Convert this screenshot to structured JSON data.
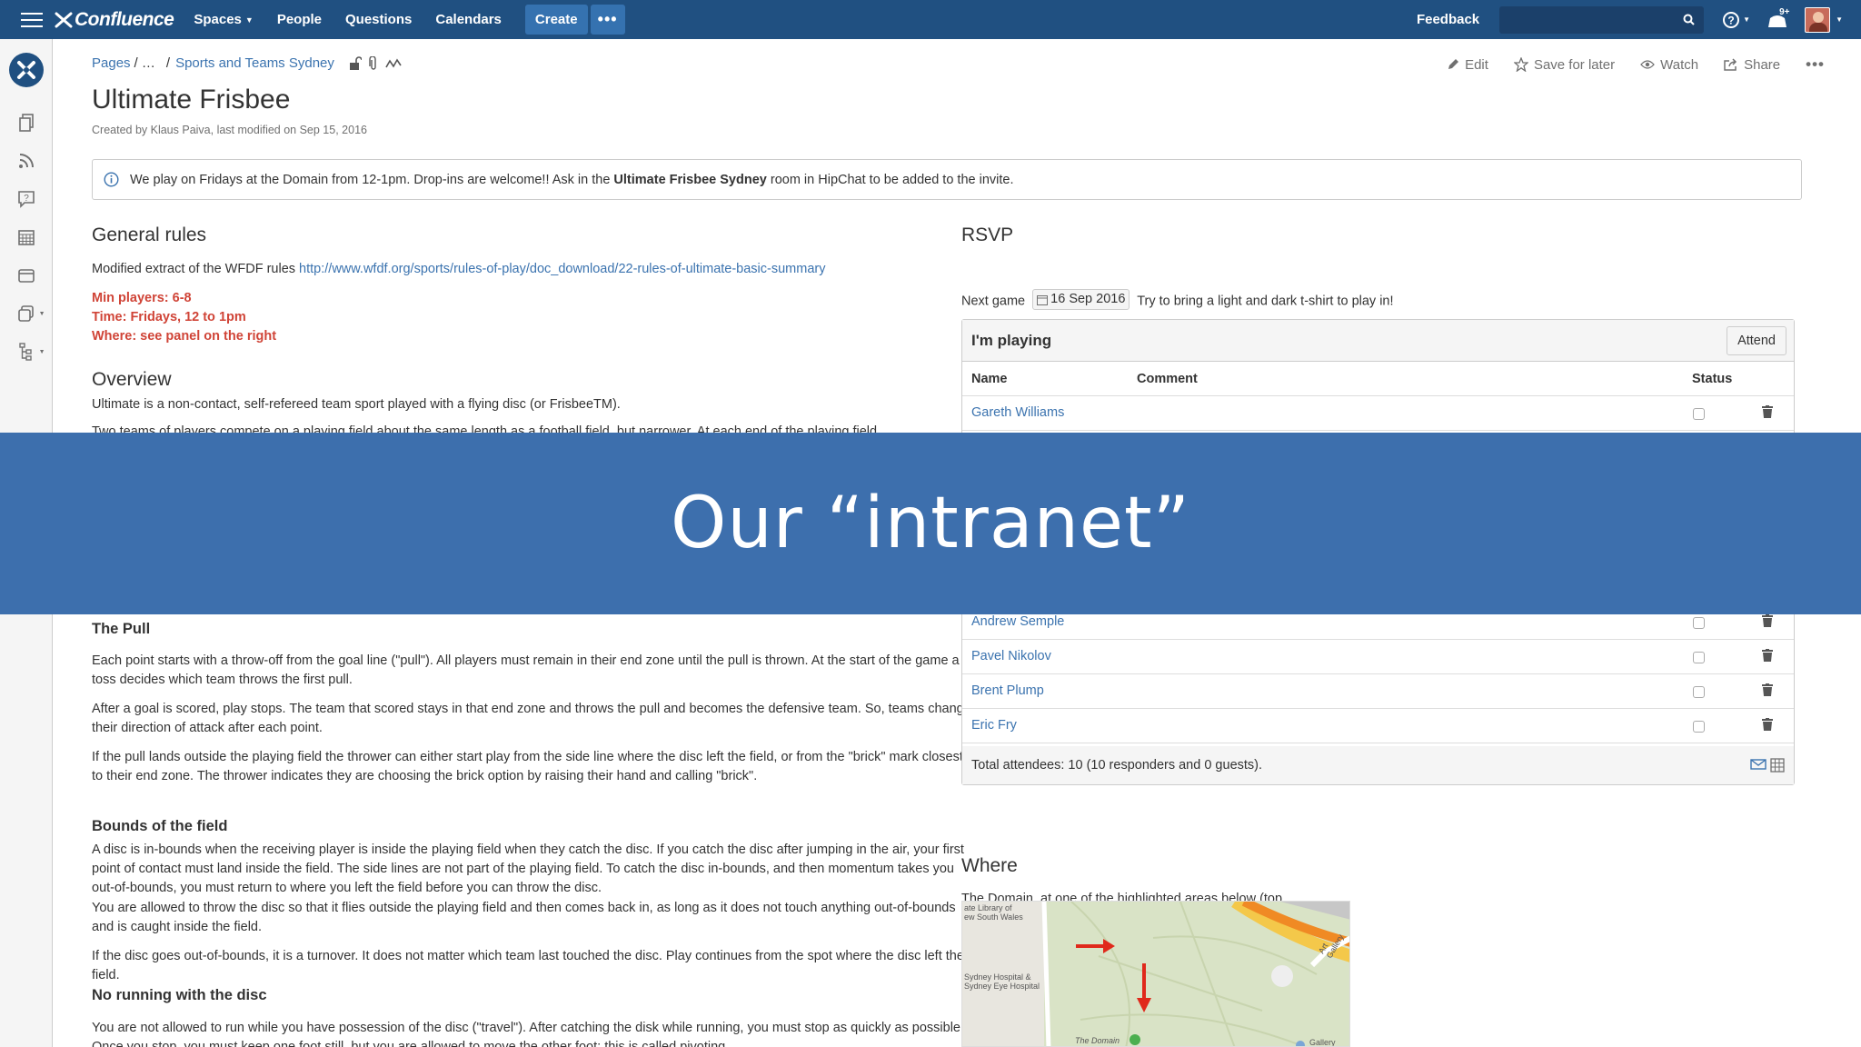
{
  "nav": {
    "app_name": "Confluence",
    "items": [
      {
        "label": "Spaces",
        "has_caret": true
      },
      {
        "label": "People",
        "has_caret": false
      },
      {
        "label": "Questions",
        "has_caret": false
      },
      {
        "label": "Calendars",
        "has_caret": false
      }
    ],
    "create_label": "Create",
    "more_label": "•••",
    "feedback_label": "Feedback",
    "notifications_badge": "9+"
  },
  "breadcrumb": {
    "root": "Pages",
    "ellipsis": "/ …",
    "sep": "/",
    "parent": "Sports and Teams Sydney"
  },
  "page_actions": {
    "edit": "Edit",
    "save_for_later": "Save for later",
    "watch": "Watch",
    "share": "Share",
    "more": "•••"
  },
  "page": {
    "title": "Ultimate Frisbee",
    "byline": "Created by Klaus Paiva, last modified on Sep 15, 2016"
  },
  "info_panel": {
    "text_before": "We play on Fridays at the Domain from 12-1pm. Drop-ins are welcome!! Ask in the ",
    "bold": "Ultimate Frisbee Sydney",
    "text_after": " room in HipChat to be added to the invite."
  },
  "general_rules": {
    "heading": "General rules",
    "extract_text": "Modified extract of the WFDF rules ",
    "extract_link": "http://www.wfdf.org/sports/rules-of-play/doc_download/22-rules-of-ultimate-basic-summary",
    "red_lines": [
      "Min players: 6-8",
      "Time: Fridays, 12 to 1pm",
      "Where: see panel on the right"
    ]
  },
  "overview": {
    "heading": "Overview",
    "line1": "Ultimate is a non-contact, self-refereed team sport played with a flying disc (or FrisbeeTM).",
    "line2_partial": "Two teams of players compete on a playing field about the same length as a football field, but narrower. At each end of the playing field"
  },
  "the_pull": {
    "heading": "The Pull",
    "p1": "Each point starts with a throw-off from the goal line (\"pull\"). All players must remain in their end zone until the pull is thrown. At the start of the game a toss decides which team throws the first pull.",
    "p2": "After a goal is scored, play stops. The team that scored stays in that end zone and throws the pull and becomes the defensive team. So, teams change their direction of attack after each point.",
    "p3": "If the pull lands outside the playing field the thrower can either start play from the side line where the disc left the field, or from the \"brick\" mark closest to their end zone. The thrower indicates they are choosing the brick option by raising their hand and calling \"brick\"."
  },
  "bounds": {
    "heading": "Bounds of the field",
    "p1": "A disc is in-bounds when the receiving player is inside the playing field when they catch the disc. If you catch the disc after jumping in the air, your first point of contact must land inside the field. The side lines are not part of the playing field. To catch the disc in-bounds, and then momentum takes you out-of-bounds, you must return to where you left the field before you can throw the disc.",
    "p2": "You are allowed to throw the disc so that it flies outside the playing field and then comes back in, as long as it does not touch anything out-of-bounds and is caught inside the field.",
    "p3": "If the disc goes out-of-bounds, it is a turnover. It does not matter which team last touched the disc. Play continues from the spot where the disc left the field."
  },
  "no_running": {
    "heading": "No running with the disc",
    "p1": "You are not allowed to run while you have possession of the disc (\"travel\"). After catching the disk while running, you must stop as quickly as possible. Once you stop, you must keep one foot still, but you are allowed to move the other foot; this is called pivoting."
  },
  "rsvp": {
    "heading": "RSVP",
    "next_game_label": "Next game",
    "next_game_date": "16 Sep 2016",
    "next_game_note": "Try to bring a light and dark t-shirt to play in!",
    "box_title": "I'm playing",
    "attend_label": "Attend",
    "columns": {
      "name": "Name",
      "comment": "Comment",
      "status": "Status"
    },
    "rows_top": [
      "Gareth Williams"
    ],
    "rows_bottom": [
      "Andrew Semple",
      "Pavel Nikolov",
      "Brent Plump",
      "Eric Fry"
    ],
    "total": "Total attendees: 10 (10 responders and 0 guests)."
  },
  "where": {
    "heading": "Where",
    "text": "The Domain, at one of the highlighted areas below (top to bottom of the image, in order to preference):",
    "map_labels": {
      "library": "ate Library of\new South Wales",
      "hospital": "Sydney Hospital &\nSydney Eye Hospital",
      "domain": "The Domain",
      "gallery_rd": "Art Gallery",
      "gallery": "Gallery"
    }
  },
  "banner": {
    "text": "Our “intranet”"
  },
  "colors": {
    "nav_bg": "#205081",
    "link": "#3b73af",
    "red": "#d04437",
    "banner": "#3d6fad"
  }
}
